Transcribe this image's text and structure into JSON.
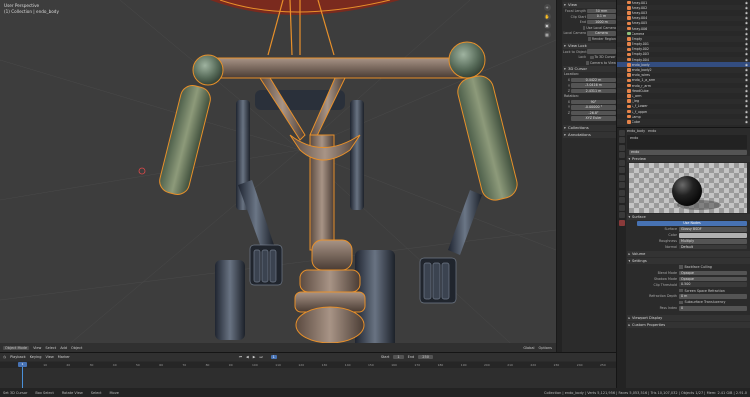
{
  "viewport": {
    "title": "User Perspective",
    "collection": "(1) Collection | endo_body",
    "header": {
      "mode": "Object Mode",
      "menus": [
        "View",
        "Select",
        "Add",
        "Object"
      ],
      "pivot": "Global",
      "options": "Options"
    }
  },
  "npanel": {
    "view_header": "View",
    "focal_length": {
      "label": "Focal Length",
      "value": "50 mm"
    },
    "clip_start": {
      "label": "Clip Start",
      "value": "0.1 m"
    },
    "clip_end": {
      "label": "End",
      "value": "1000 m"
    },
    "use_local_camera": "Use Local Camera",
    "local_camera": {
      "label": "Local Camera",
      "value": "Camera"
    },
    "render_region": "Render Region",
    "view_lock_header": "View Lock",
    "lock_to_object": {
      "label": "Lock to Object"
    },
    "lock": {
      "label": "Lock",
      "to_3d_cursor": "To 3D Cursor",
      "camera_to_view": "Camera to View"
    },
    "cursor_header": "3D Cursor",
    "location_label": "Location:",
    "location": [
      {
        "axis": "X",
        "value": "0.4422 m"
      },
      {
        "axis": "Y",
        "value": "-3.0416 m"
      },
      {
        "axis": "Z",
        "value": "2.4311 m"
      }
    ],
    "rotation_label": "Rotation:",
    "rotation": [
      {
        "axis": "X",
        "value": "90°"
      },
      {
        "axis": "Y",
        "value": "-0.00000 °"
      },
      {
        "axis": "Z",
        "value": "-26.8°"
      }
    ],
    "rotation_mode": "XYZ Euler",
    "collections_header": "Collections",
    "annotations_header": "Annotations"
  },
  "outliner": {
    "rows": [
      {
        "name": "Array.001",
        "color": "#e6844a",
        "selected": false
      },
      {
        "name": "Array.002",
        "color": "#e6844a",
        "selected": false
      },
      {
        "name": "Array.003",
        "color": "#e6844a",
        "selected": false
      },
      {
        "name": "Array.004",
        "color": "#e6844a",
        "selected": false
      },
      {
        "name": "Array.005",
        "color": "#e6844a",
        "selected": false
      },
      {
        "name": "Array.006",
        "color": "#e6844a",
        "selected": false
      },
      {
        "name": "Camera",
        "color": "#8ec07c",
        "selected": false
      },
      {
        "name": "Empty",
        "color": "#e6844a",
        "selected": false
      },
      {
        "name": "Empty.001",
        "color": "#e6844a",
        "selected": false
      },
      {
        "name": "Empty.002",
        "color": "#e6844a",
        "selected": false
      },
      {
        "name": "Empty.003",
        "color": "#e6844a",
        "selected": false
      },
      {
        "name": "Empty.004",
        "color": "#e6844a",
        "selected": false
      },
      {
        "name": "endo_body",
        "color": "#e6844a",
        "selected": true
      },
      {
        "name": "endo_body2",
        "color": "#e6844a",
        "selected": false
      },
      {
        "name": "endo_wires",
        "color": "#e6844a",
        "selected": false
      },
      {
        "name": "endo_1_a_arm",
        "color": "#e6844a",
        "selected": false
      },
      {
        "name": "endo_r_arm",
        "color": "#e6844a",
        "selected": false
      },
      {
        "name": "HeadCube",
        "color": "#e6844a",
        "selected": false
      },
      {
        "name": "L_arm",
        "color": "#e6844a",
        "selected": false
      },
      {
        "name": "l_leg",
        "color": "#e6844a",
        "selected": false
      },
      {
        "name": "L_f_Lower",
        "color": "#e6844a",
        "selected": false
      },
      {
        "name": "L_f_upper",
        "color": "#e6844a",
        "selected": false
      },
      {
        "name": "Lamp",
        "color": "#e6844a",
        "selected": false
      },
      {
        "name": "Cube",
        "color": "#e6844a",
        "selected": false
      }
    ]
  },
  "properties": {
    "breadcrumb_object": "endo_body",
    "breadcrumb_material": "endo",
    "slot_name": "endo",
    "material_field": "endo",
    "preview_header": "Preview",
    "surface_header": "Surface",
    "use_nodes": "Use Nodes",
    "surface": {
      "label": "Surface",
      "value": "Glossy BSDF"
    },
    "color": {
      "label": "Color"
    },
    "roughness": {
      "label": "Roughness",
      "value": "Multiply"
    },
    "normal": {
      "label": "Normal",
      "value": "Default"
    },
    "volume_header": "Volume",
    "settings_header": "Settings",
    "backface_culling": "Backface Culling",
    "blend_mode": {
      "label": "Blend Mode",
      "value": "Opaque"
    },
    "shadow_mode": {
      "label": "Shadow Mode",
      "value": "Opaque"
    },
    "clip_threshold": {
      "label": "Clip Threshold",
      "value": "0.500"
    },
    "screen_space_refraction": "Screen Space Refraction",
    "refraction_depth": {
      "label": "Refraction Depth",
      "value": "0 m"
    },
    "subsurface_translucency": "Subsurface Translucency",
    "pass_index": {
      "label": "Pass Index",
      "value": "0"
    },
    "viewport_display_header": "Viewport Display",
    "custom_properties_header": "Custom Properties"
  },
  "timeline": {
    "menus": [
      "Playback",
      "Keying",
      "View",
      "Marker"
    ],
    "current_frame": "1",
    "ticks": [
      "0",
      "10",
      "20",
      "30",
      "40",
      "50",
      "60",
      "70",
      "80",
      "90",
      "100",
      "110",
      "120",
      "130",
      "140",
      "150",
      "160",
      "170",
      "180",
      "190",
      "200",
      "210",
      "220",
      "230",
      "240",
      "250"
    ],
    "start_label": "Start",
    "start": "1",
    "end_label": "End",
    "end": "250"
  },
  "statusbar": {
    "left1": "Set 3D Cursor",
    "left2": "Box Select",
    "left3": "Rotate View",
    "left4": "Select",
    "left5": "Move",
    "right": "Collection | endo_body | Verts 5,121,956 | Faces 5,053,516 | Tris 10,107,032 | Objects 1/27 | Mem: 2.41 GiB | 2.91.0"
  },
  "colors": {
    "accent": "#4772b3",
    "selection": "#e8902a",
    "viewport_bg": "#3d3d3d"
  }
}
